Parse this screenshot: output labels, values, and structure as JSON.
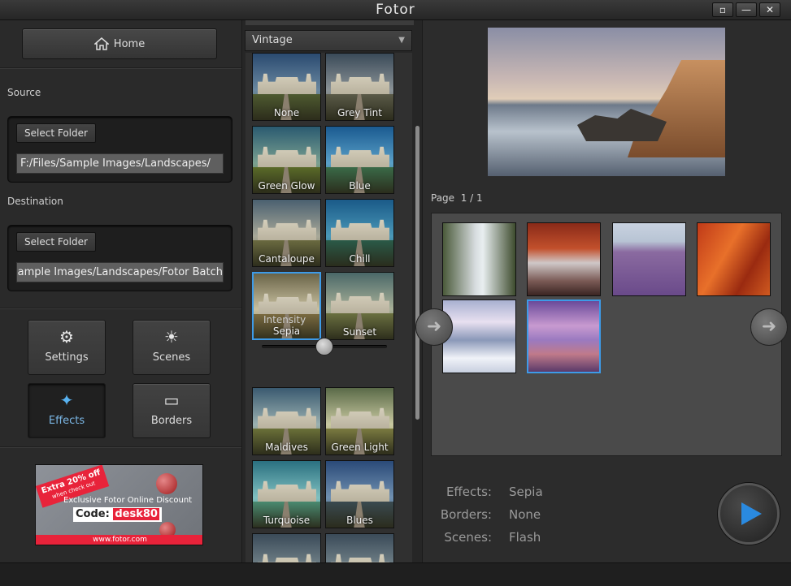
{
  "window": {
    "title": "Fotor",
    "restore_icon": "▫",
    "minimize_icon": "—",
    "close_icon": "✕"
  },
  "left": {
    "home_label": "Home",
    "source": {
      "label": "Source",
      "button": "Select Folder",
      "path": "F:/Files/Sample Images/Landscapes/"
    },
    "destination": {
      "label": "Destination",
      "button": "Select Folder",
      "path": "F:/Files/Sample Images/Landscapes/Fotor Batch"
    },
    "tools": [
      {
        "label": "Settings",
        "icon": "gear-icon",
        "glyph": "⚙"
      },
      {
        "label": "Scenes",
        "icon": "sun-icon",
        "glyph": "☀"
      },
      {
        "label": "Effects",
        "icon": "sparkle-icon",
        "glyph": "✦"
      },
      {
        "label": "Borders",
        "icon": "frame-icon",
        "glyph": "▭"
      }
    ],
    "promo": {
      "ribbon": "Extra 20% off",
      "ribbon_sub": "when check out",
      "line": "Exclusive Fotor Online Discount",
      "code_label": "Code:",
      "code": "desk80",
      "url": "www.fotor.com"
    }
  },
  "middle": {
    "category": "Vintage",
    "effects": [
      "None",
      "Grey Tint",
      "Green Glow",
      "Blue",
      "Cantaloupe",
      "Chill",
      "Sepia",
      "Sunset",
      "Maldives",
      "Green Light",
      "Turquoise",
      "Blues"
    ],
    "selected": "Sepia",
    "intensity_label": "Intensity",
    "intensity_value": 0.5
  },
  "right": {
    "page_label": "Page",
    "page_current": "1",
    "page_sep": "/",
    "page_total": "1",
    "summary": [
      {
        "key": "Effects:",
        "value": "Sepia"
      },
      {
        "key": "Borders:",
        "value": "None"
      },
      {
        "key": "Scenes:",
        "value": "Flash"
      }
    ]
  },
  "colors": {
    "accent": "#3d9be8",
    "panel": "#2b2b2b"
  }
}
